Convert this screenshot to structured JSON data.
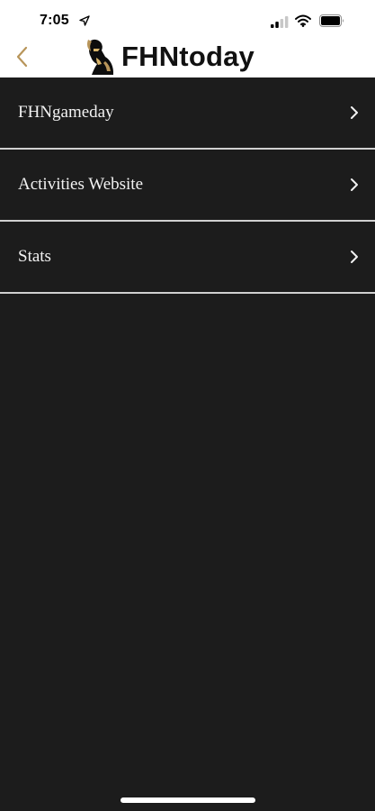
{
  "status_bar": {
    "time": "7:05",
    "icons": [
      "location-arrow-icon",
      "cellular-signal-icon",
      "wifi-icon",
      "battery-icon"
    ]
  },
  "nav": {
    "back_icon": "chevron-left-icon",
    "logo_icon": "knight-helmet-icon",
    "title": "FHNtoday"
  },
  "menu": {
    "items": [
      {
        "label": "FHNgameday",
        "icon": "chevron-right-icon"
      },
      {
        "label": "Activities Website",
        "icon": "chevron-right-icon"
      },
      {
        "label": "Stats",
        "icon": "chevron-right-icon"
      }
    ]
  },
  "colors": {
    "background": "#1c1c1c",
    "header_background": "#ffffff",
    "accent_gold": "#b8955a",
    "divider": "#d0d0d0",
    "text": "#f2f2f2"
  }
}
